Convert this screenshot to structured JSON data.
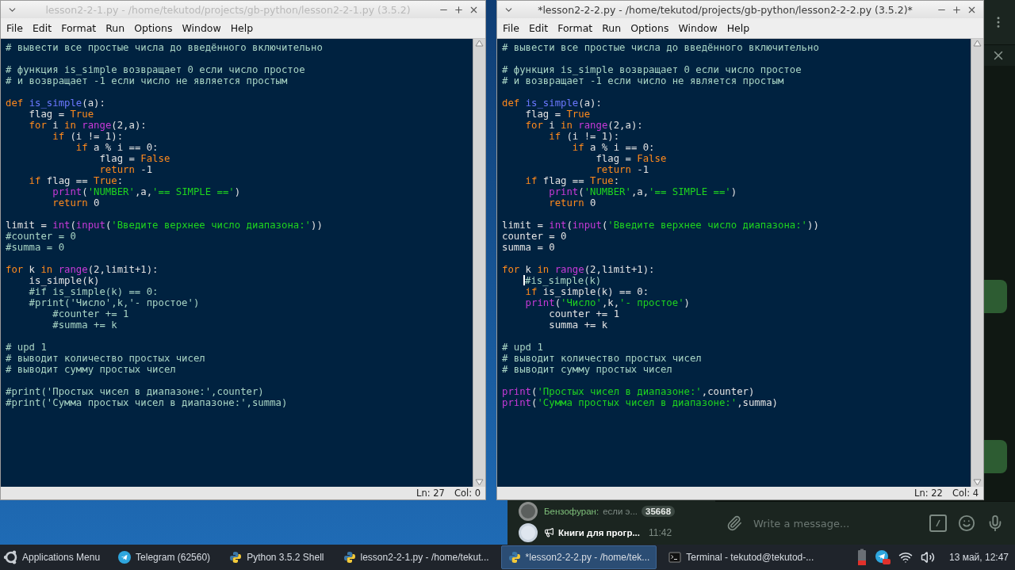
{
  "windows": [
    {
      "title": "lesson2-2-1.py - /home/tekutod/projects/gb-python/lesson2-2-1.py (3.5.2)",
      "active": false,
      "menu": [
        "File",
        "Edit",
        "Format",
        "Run",
        "Options",
        "Window",
        "Help"
      ],
      "code_blocks": [
        [
          [
            {
              "kind": "comment",
              "text": "# вывести все простые числа до введённого включительно"
            }
          ]
        ],
        [
          [
            {
              "kind": "comment",
              "text": "# функция is_simple возвращает 0 если число простое"
            }
          ],
          [
            {
              "kind": "comment",
              "text": "# и возвращает -1 если число не является простым"
            }
          ]
        ],
        [
          [
            {
              "kind": "keyword",
              "text": "def "
            },
            {
              "kind": "definition",
              "text": "is_simple"
            },
            {
              "kind": "plain",
              "text": "(a):"
            }
          ],
          [
            {
              "kind": "plain",
              "text": "    flag = "
            },
            {
              "kind": "keyword",
              "text": "True"
            }
          ],
          [
            {
              "kind": "keyword",
              "text": "    for"
            },
            {
              "kind": "plain",
              "text": " i "
            },
            {
              "kind": "keyword",
              "text": "in "
            },
            {
              "kind": "builtin",
              "text": "range"
            },
            {
              "kind": "plain",
              "text": "(2,a):"
            }
          ],
          [
            {
              "kind": "keyword",
              "text": "        if"
            },
            {
              "kind": "plain",
              "text": " (i != 1):"
            }
          ],
          [
            {
              "kind": "keyword",
              "text": "            if"
            },
            {
              "kind": "plain",
              "text": " a % i == 0:"
            }
          ],
          [
            {
              "kind": "plain",
              "text": "                flag = "
            },
            {
              "kind": "keyword",
              "text": "False"
            }
          ],
          [
            {
              "kind": "keyword",
              "text": "                return"
            },
            {
              "kind": "plain",
              "text": " -1"
            }
          ],
          [
            {
              "kind": "keyword",
              "text": "    if"
            },
            {
              "kind": "plain",
              "text": " flag == "
            },
            {
              "kind": "keyword",
              "text": "True"
            },
            {
              "kind": "plain",
              "text": ":"
            }
          ],
          [
            {
              "kind": "builtin",
              "text": "        print"
            },
            {
              "kind": "plain",
              "text": "("
            },
            {
              "kind": "string",
              "text": "'NUMBER'"
            },
            {
              "kind": "plain",
              "text": ",a,"
            },
            {
              "kind": "string",
              "text": "'== SIMPLE =='"
            },
            {
              "kind": "plain",
              "text": ")"
            }
          ],
          [
            {
              "kind": "keyword",
              "text": "        return"
            },
            {
              "kind": "plain",
              "text": " 0"
            }
          ]
        ],
        [
          [
            {
              "kind": "plain",
              "text": "limit = "
            },
            {
              "kind": "builtin",
              "text": "int"
            },
            {
              "kind": "plain",
              "text": "("
            },
            {
              "kind": "builtin",
              "text": "input"
            },
            {
              "kind": "plain",
              "text": "("
            },
            {
              "kind": "string",
              "text": "'Введите верхнее число диапазона:'"
            },
            {
              "kind": "plain",
              "text": "))"
            }
          ],
          [
            {
              "kind": "comment",
              "text": "#counter = 0"
            }
          ],
          [
            {
              "kind": "comment",
              "text": "#summa = 0"
            }
          ]
        ],
        [
          [
            {
              "kind": "keyword",
              "text": "for"
            },
            {
              "kind": "plain",
              "text": " k "
            },
            {
              "kind": "keyword",
              "text": "in "
            },
            {
              "kind": "builtin",
              "text": "range"
            },
            {
              "kind": "plain",
              "text": "(2,limit+1):"
            }
          ],
          [
            {
              "kind": "plain",
              "text": "    is_simple(k)"
            }
          ],
          [
            {
              "kind": "comment",
              "text": "    #if is_simple(k) == 0:"
            }
          ],
          [
            {
              "kind": "comment",
              "text": "    #print('Число',k,'- простое')"
            }
          ],
          [
            {
              "kind": "comment",
              "text": "        #counter += 1"
            }
          ],
          [
            {
              "kind": "comment",
              "text": "        #summa += k"
            }
          ]
        ],
        [
          [
            {
              "kind": "comment",
              "text": "# upd 1"
            }
          ],
          [
            {
              "kind": "comment",
              "text": "# выводит количество простых чисел"
            }
          ],
          [
            {
              "kind": "comment",
              "text": "# выводит сумму простых чисел"
            }
          ]
        ],
        [
          [
            {
              "kind": "comment",
              "text": "#print('Простых чисел в диапазоне:',counter)"
            }
          ],
          [
            {
              "kind": "comment",
              "text": "#print('Сумма простых чисел в диапазоне:',summa)"
            }
          ]
        ]
      ],
      "status": {
        "line": "Ln: 27",
        "column": "Col: 0"
      }
    },
    {
      "title": "*lesson2-2-2.py - /home/tekutod/projects/gb-python/lesson2-2-2.py (3.5.2)*",
      "active": true,
      "menu": [
        "File",
        "Edit",
        "Format",
        "Run",
        "Options",
        "Window",
        "Help"
      ],
      "code_blocks": [
        [
          [
            {
              "kind": "comment",
              "text": "# вывести все простые числа до введённого включительно"
            }
          ]
        ],
        [
          [
            {
              "kind": "comment",
              "text": "# функция is_simple возвращает 0 если число простое"
            }
          ],
          [
            {
              "kind": "comment",
              "text": "# и возвращает -1 если число не является простым"
            }
          ]
        ],
        [
          [
            {
              "kind": "keyword",
              "text": "def "
            },
            {
              "kind": "definition",
              "text": "is_simple"
            },
            {
              "kind": "plain",
              "text": "(a):"
            }
          ],
          [
            {
              "kind": "plain",
              "text": "    flag = "
            },
            {
              "kind": "keyword",
              "text": "True"
            }
          ],
          [
            {
              "kind": "keyword",
              "text": "    for"
            },
            {
              "kind": "plain",
              "text": " i "
            },
            {
              "kind": "keyword",
              "text": "in "
            },
            {
              "kind": "builtin",
              "text": "range"
            },
            {
              "kind": "plain",
              "text": "(2,a):"
            }
          ],
          [
            {
              "kind": "keyword",
              "text": "        if"
            },
            {
              "kind": "plain",
              "text": " (i != 1):"
            }
          ],
          [
            {
              "kind": "keyword",
              "text": "            if"
            },
            {
              "kind": "plain",
              "text": " a % i == 0:"
            }
          ],
          [
            {
              "kind": "plain",
              "text": "                flag = "
            },
            {
              "kind": "keyword",
              "text": "False"
            }
          ],
          [
            {
              "kind": "keyword",
              "text": "                return"
            },
            {
              "kind": "plain",
              "text": " -1"
            }
          ],
          [
            {
              "kind": "keyword",
              "text": "    if"
            },
            {
              "kind": "plain",
              "text": " flag == "
            },
            {
              "kind": "keyword",
              "text": "True"
            },
            {
              "kind": "plain",
              "text": ":"
            }
          ],
          [
            {
              "kind": "builtin",
              "text": "        print"
            },
            {
              "kind": "plain",
              "text": "("
            },
            {
              "kind": "string",
              "text": "'NUMBER'"
            },
            {
              "kind": "plain",
              "text": ",a,"
            },
            {
              "kind": "string",
              "text": "'== SIMPLE =='"
            },
            {
              "kind": "plain",
              "text": ")"
            }
          ],
          [
            {
              "kind": "keyword",
              "text": "        return"
            },
            {
              "kind": "plain",
              "text": " 0"
            }
          ]
        ],
        [
          [
            {
              "kind": "plain",
              "text": "limit = "
            },
            {
              "kind": "builtin",
              "text": "int"
            },
            {
              "kind": "plain",
              "text": "("
            },
            {
              "kind": "builtin",
              "text": "input"
            },
            {
              "kind": "plain",
              "text": "("
            },
            {
              "kind": "string",
              "text": "'Введите верхнее число диапазона:'"
            },
            {
              "kind": "plain",
              "text": "))"
            }
          ],
          [
            {
              "kind": "plain",
              "text": "counter = 0"
            }
          ],
          [
            {
              "kind": "plain",
              "text": "summa = 0"
            }
          ]
        ],
        [
          [
            {
              "kind": "keyword",
              "text": "for"
            },
            {
              "kind": "plain",
              "text": " k "
            },
            {
              "kind": "keyword",
              "text": "in "
            },
            {
              "kind": "builtin",
              "text": "range"
            },
            {
              "kind": "plain",
              "text": "(2,limit+1):"
            }
          ],
          [
            {
              "kind": "comment",
              "text": "#is_simple(k)",
              "caret": true
            }
          ],
          [
            {
              "kind": "keyword",
              "text": "    if"
            },
            {
              "kind": "plain",
              "text": " is_simple(k) == 0:"
            }
          ],
          [
            {
              "kind": "builtin",
              "text": "    print"
            },
            {
              "kind": "plain",
              "text": "("
            },
            {
              "kind": "string",
              "text": "'Число'"
            },
            {
              "kind": "plain",
              "text": ",k,"
            },
            {
              "kind": "string",
              "text": "'- простое'"
            },
            {
              "kind": "plain",
              "text": ")"
            }
          ],
          [
            {
              "kind": "plain",
              "text": "        counter += 1"
            }
          ],
          [
            {
              "kind": "plain",
              "text": "        summa += k"
            }
          ]
        ],
        [
          [
            {
              "kind": "comment",
              "text": "# upd 1"
            }
          ],
          [
            {
              "kind": "comment",
              "text": "# выводит количество простых чисел"
            }
          ],
          [
            {
              "kind": "comment",
              "text": "# выводит сумму простых чисел"
            }
          ]
        ],
        [
          [
            {
              "kind": "builtin",
              "text": "print"
            },
            {
              "kind": "plain",
              "text": "("
            },
            {
              "kind": "string",
              "text": "'Простых чисел в диапазоне:'"
            },
            {
              "kind": "plain",
              "text": ",counter)"
            }
          ],
          [
            {
              "kind": "builtin",
              "text": "print"
            },
            {
              "kind": "plain",
              "text": "("
            },
            {
              "kind": "string",
              "text": "'Сумма простых чисел в диапазоне:'"
            },
            {
              "kind": "plain",
              "text": ",summa)"
            }
          ]
        ]
      ],
      "status": {
        "line": "Ln: 22",
        "column": "Col: 4"
      }
    }
  ],
  "telegram": {
    "chats": [
      {
        "kind": "group",
        "name": "Бензофуран:",
        "preview": "если э...",
        "badge": "35668"
      },
      {
        "kind": "channel",
        "name": "Книги для прогр...",
        "time": "11:42"
      }
    ],
    "composer": {
      "placeholder": "Write a message..."
    }
  },
  "taskbar": {
    "menu_label": "Applications Menu",
    "tasks": [
      {
        "kind": "telegram",
        "label": "Telegram (62560)",
        "selected": false
      },
      {
        "kind": "python",
        "label": "Python 3.5.2 Shell",
        "selected": false
      },
      {
        "kind": "python",
        "label": "lesson2-2-1.py - /home/tekut...",
        "selected": false
      },
      {
        "kind": "python",
        "label": "*lesson2-2-2.py - /home/tek...",
        "selected": true
      },
      {
        "kind": "terminal",
        "label": "Terminal - tekutod@tekutod-...",
        "selected": false
      }
    ],
    "clock": "13 май, 12:47"
  }
}
